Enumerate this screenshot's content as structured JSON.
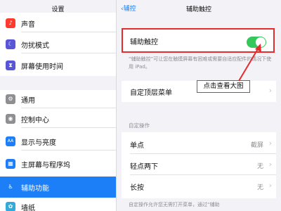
{
  "sidebar": {
    "title": "设置",
    "items": [
      {
        "label": "声音",
        "icon": "speaker-icon",
        "glyph": "♪",
        "color": "#ff3b30"
      },
      {
        "label": "勿扰模式",
        "icon": "moon-icon",
        "glyph": "☾",
        "color": "#5856d6"
      },
      {
        "label": "屏幕使用时间",
        "icon": "hourglass-icon",
        "glyph": "⧗",
        "color": "#5856d6"
      },
      {
        "label": "通用",
        "icon": "gear-icon",
        "glyph": "⚙",
        "color": "#8e8e93"
      },
      {
        "label": "控制中心",
        "icon": "toggles-icon",
        "glyph": "◉",
        "color": "#8e8e93"
      },
      {
        "label": "显示与亮度",
        "icon": "display-icon",
        "glyph": "AA",
        "color": "#1d7ff7"
      },
      {
        "label": "主屏幕与程序坞",
        "icon": "grid-icon",
        "glyph": "▦",
        "color": "#1d7ff7"
      },
      {
        "label": "辅助功能",
        "icon": "accessibility-icon",
        "glyph": "♿",
        "color": "#1d7ff7"
      },
      {
        "label": "墙纸",
        "icon": "flower-icon",
        "glyph": "✿",
        "color": "#34aadc"
      }
    ]
  },
  "pane": {
    "back_label": "辅控",
    "back_chevron": "‹",
    "title": "辅助触控",
    "toggle_label": "辅助触控",
    "toggle_on": true,
    "description": "“辅助触控”可让您在触摸屏幕有困难或需要自适应配件的情况下使用 iPad。",
    "top_menu_label": "自定顶层菜单",
    "chevron": "›",
    "section_header": "自定操作",
    "actions": [
      {
        "label": "单点",
        "value": "截屏"
      },
      {
        "label": "轻点两下",
        "value": "无"
      },
      {
        "label": "长按",
        "value": "无"
      }
    ],
    "footer": "自定操作允许您无需打开菜单，通过“辅助"
  },
  "tooltip": {
    "text": "点击查看大图"
  },
  "colors": {
    "accent": "#1d7ff7",
    "toggle": "#34c759",
    "highlight": "#e52b2b"
  }
}
